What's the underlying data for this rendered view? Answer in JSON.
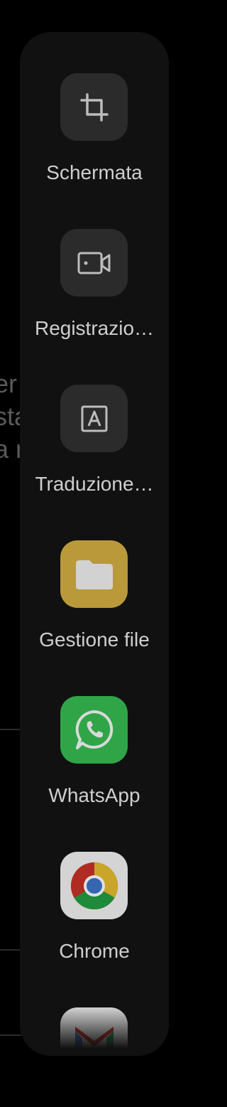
{
  "background": {
    "text_lines": [
      "er",
      "sta",
      "a r"
    ]
  },
  "sidebar": {
    "items": [
      {
        "label": "Schermata",
        "icon": "crop-icon"
      },
      {
        "label": "Registrazio…",
        "icon": "screen-record-icon"
      },
      {
        "label": "Traduzione…",
        "icon": "translate-icon"
      },
      {
        "label": "Gestione file",
        "icon": "folder-icon"
      },
      {
        "label": "WhatsApp",
        "icon": "whatsapp-icon"
      },
      {
        "label": "Chrome",
        "icon": "chrome-icon"
      },
      {
        "label": "",
        "icon": "gmail-icon"
      }
    ]
  },
  "colors": {
    "panel": "#111111",
    "tile": "#2b2b2b",
    "files_tile": "#b9993a",
    "whatsapp_tile": "#2fa548",
    "label": "#cfcfcf"
  }
}
